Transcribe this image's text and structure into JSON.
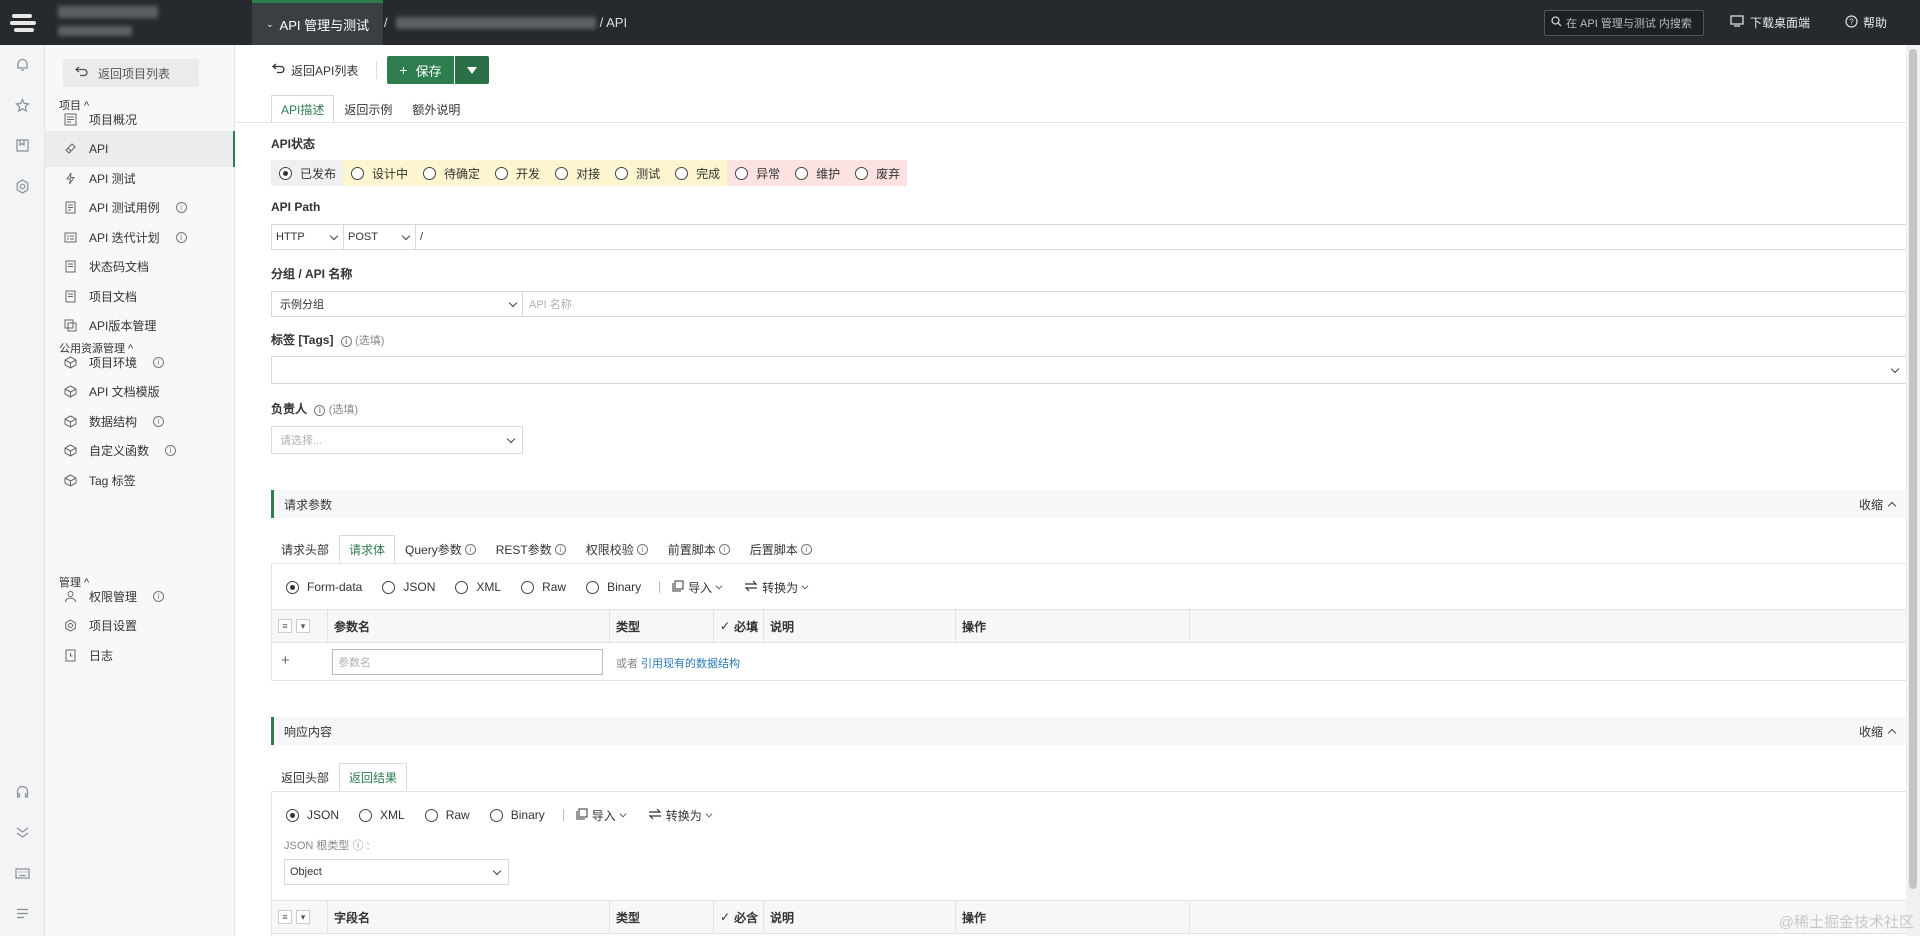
{
  "topbar": {
    "module": "API 管理与测试",
    "crumb_sep": "/",
    "crumb_current": "/ API",
    "search_placeholder": "在 API 管理与测试 内搜索",
    "download": "下载桌面端",
    "help": "帮助"
  },
  "sidebar": {
    "back": "返回项目列表",
    "sections": [
      {
        "title": "项目 ^",
        "items": [
          {
            "label": "项目概况",
            "icon": "overview-icon",
            "info": false
          },
          {
            "label": "API",
            "icon": "api-icon",
            "info": false,
            "active": true
          },
          {
            "label": "API 测试",
            "icon": "bolt-icon",
            "info": false
          },
          {
            "label": "API 测试用例",
            "icon": "case-icon",
            "info": true
          },
          {
            "label": "API 迭代计划",
            "icon": "plan-icon",
            "info": true
          },
          {
            "label": "状态码文档",
            "icon": "doc-icon",
            "info": false
          },
          {
            "label": "项目文档",
            "icon": "doc-icon",
            "info": false
          },
          {
            "label": "API版本管理",
            "icon": "version-icon",
            "info": false
          }
        ]
      },
      {
        "title": "公用资源管理 ^",
        "items": [
          {
            "label": "项目环境",
            "icon": "cube-icon",
            "info": true
          },
          {
            "label": "API 文档模版",
            "icon": "cube-icon",
            "info": false
          },
          {
            "label": "数据结构",
            "icon": "cube-icon",
            "info": true
          },
          {
            "label": "自定义函数",
            "icon": "cube-icon",
            "info": true
          },
          {
            "label": "Tag 标签",
            "icon": "cube-icon",
            "info": false
          }
        ]
      },
      {
        "title": "管理 ^",
        "items": [
          {
            "label": "权限管理",
            "icon": "user-icon",
            "info": true
          },
          {
            "label": "项目设置",
            "icon": "gear-icon",
            "info": false
          },
          {
            "label": "日志",
            "icon": "log-icon",
            "info": false
          }
        ]
      }
    ]
  },
  "toolbar": {
    "back": "返回API列表",
    "save": "保存"
  },
  "tabs": [
    "API描述",
    "返回示例",
    "额外说明"
  ],
  "form": {
    "status_label": "API状态",
    "statuses": [
      {
        "label": "已发布",
        "color": "#eef0f2",
        "on": true
      },
      {
        "label": "设计中",
        "color": "#fdf5cf"
      },
      {
        "label": "待确定",
        "color": "#fdf5cf"
      },
      {
        "label": "开发",
        "color": "#fdf5cf"
      },
      {
        "label": "对接",
        "color": "#fdf5cf"
      },
      {
        "label": "测试",
        "color": "#fdf5cf"
      },
      {
        "label": "完成",
        "color": "#fdf5cf"
      },
      {
        "label": "异常",
        "color": "#fde2e2"
      },
      {
        "label": "维护",
        "color": "#fde2e2"
      },
      {
        "label": "废弃",
        "color": "#fde2e2"
      }
    ],
    "path_label": "API Path",
    "protocol": "HTTP",
    "method": "POST",
    "path_value": "/",
    "group_label": "分组 / API 名称",
    "group_value": "示例分组",
    "name_placeholder": "API 名称",
    "tags_label": "标签 [Tags]",
    "optional": "(选填)",
    "owner_label": "负责人",
    "owner_placeholder": "请选择..."
  },
  "request": {
    "title": "请求参数",
    "collapse": "收缩",
    "subtabs": [
      {
        "label": "请求头部",
        "info": false
      },
      {
        "label": "请求体",
        "info": false,
        "active": true
      },
      {
        "label": "Query参数",
        "info": true
      },
      {
        "label": "REST参数",
        "info": true
      },
      {
        "label": "权限校验",
        "info": true
      },
      {
        "label": "前置脚本",
        "info": true
      },
      {
        "label": "后置脚本",
        "info": true
      }
    ],
    "formats": [
      "Form-data",
      "JSON",
      "XML",
      "Raw",
      "Binary"
    ],
    "import": "导入",
    "convert": "转换为",
    "cols": {
      "name": "参数名",
      "type": "类型",
      "required": "必填",
      "desc": "说明",
      "action": "操作"
    },
    "name_placeholder": "参数名",
    "or": "或者",
    "ref_link": "引用现有的数据结构"
  },
  "response": {
    "title": "响应内容",
    "collapse": "收缩",
    "subtabs": [
      {
        "label": "返回头部"
      },
      {
        "label": "返回结果",
        "active": true
      }
    ],
    "formats": [
      "JSON",
      "XML",
      "Raw",
      "Binary"
    ],
    "import": "导入",
    "convert": "转换为",
    "root_type_label": "JSON 根类型 ⓘ :",
    "root_type": "Object",
    "cols": {
      "name": "字段名",
      "type": "类型",
      "required": "必含",
      "desc": "说明",
      "action": "操作"
    }
  },
  "watermark": "@稀土掘金技术社区",
  "colors": {
    "accent": "#2e7d4f",
    "topbar": "#262a2e"
  }
}
